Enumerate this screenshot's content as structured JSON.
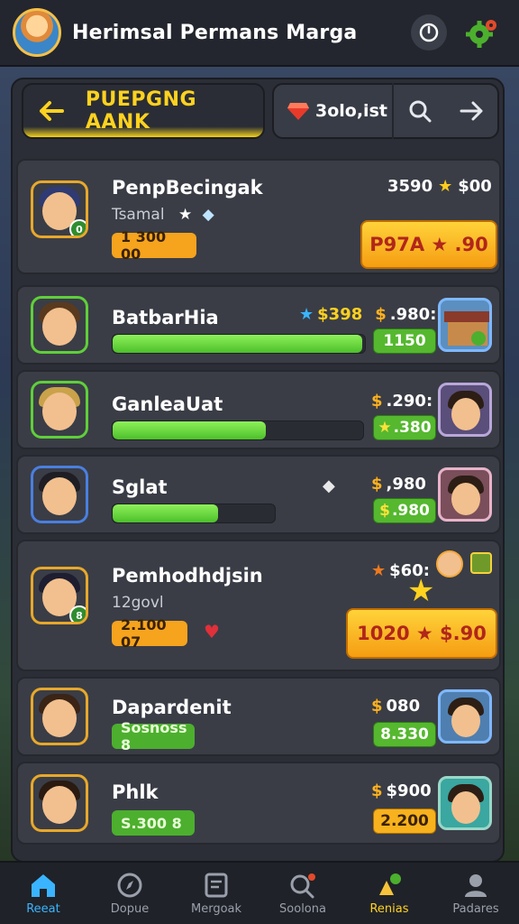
{
  "app": {
    "title": "Herimsal Permans Marga"
  },
  "header": {
    "title": "PUEPGNG AANK",
    "gem_value": "3olo,ist"
  },
  "rows": [
    {
      "name": "PenpBecingak",
      "sub": "Tsamal",
      "tag": "1 300 00",
      "price_left": "3590",
      "price_right": "$00",
      "button": "P97A ★ .90"
    },
    {
      "name": "BatbarHia",
      "progress": 0.99,
      "price_left": "$398",
      "price_right": ".980:",
      "button": "1150"
    },
    {
      "name": "GanleaUat",
      "progress": 0.61,
      "price_right": ".290:",
      "button": ".380"
    },
    {
      "name": "Sglat",
      "progress": 0.65,
      "price_right": ",980",
      "button": ".980"
    },
    {
      "name": "Pemhodhdjsin",
      "sub": "12govl",
      "tag": "2.100 07",
      "price_right": "$60:",
      "button": "1020 ★ $.90"
    },
    {
      "name": "Dapardenit",
      "tag": "Sosnoss 8",
      "price_right": "080",
      "button": "8.330"
    },
    {
      "name": "Phlk",
      "tag": "S.300 8",
      "price_right": "$900",
      "button": "2.200"
    }
  ],
  "nav": [
    {
      "label": "Reeat",
      "icon": "home-icon"
    },
    {
      "label": "Dopue",
      "icon": "compass-icon"
    },
    {
      "label": "Mergoak",
      "icon": "document-icon"
    },
    {
      "label": "Soolona",
      "icon": "search-badge-icon"
    },
    {
      "label": "Renias",
      "icon": "rewards-icon"
    },
    {
      "label": "Padares",
      "icon": "profile-icon"
    }
  ],
  "colors": {
    "accent_yellow": "#ffd21f",
    "accent_green": "#4cc02a",
    "accent_orange": "#f59d12",
    "accent_blue": "#3ab4ff"
  }
}
